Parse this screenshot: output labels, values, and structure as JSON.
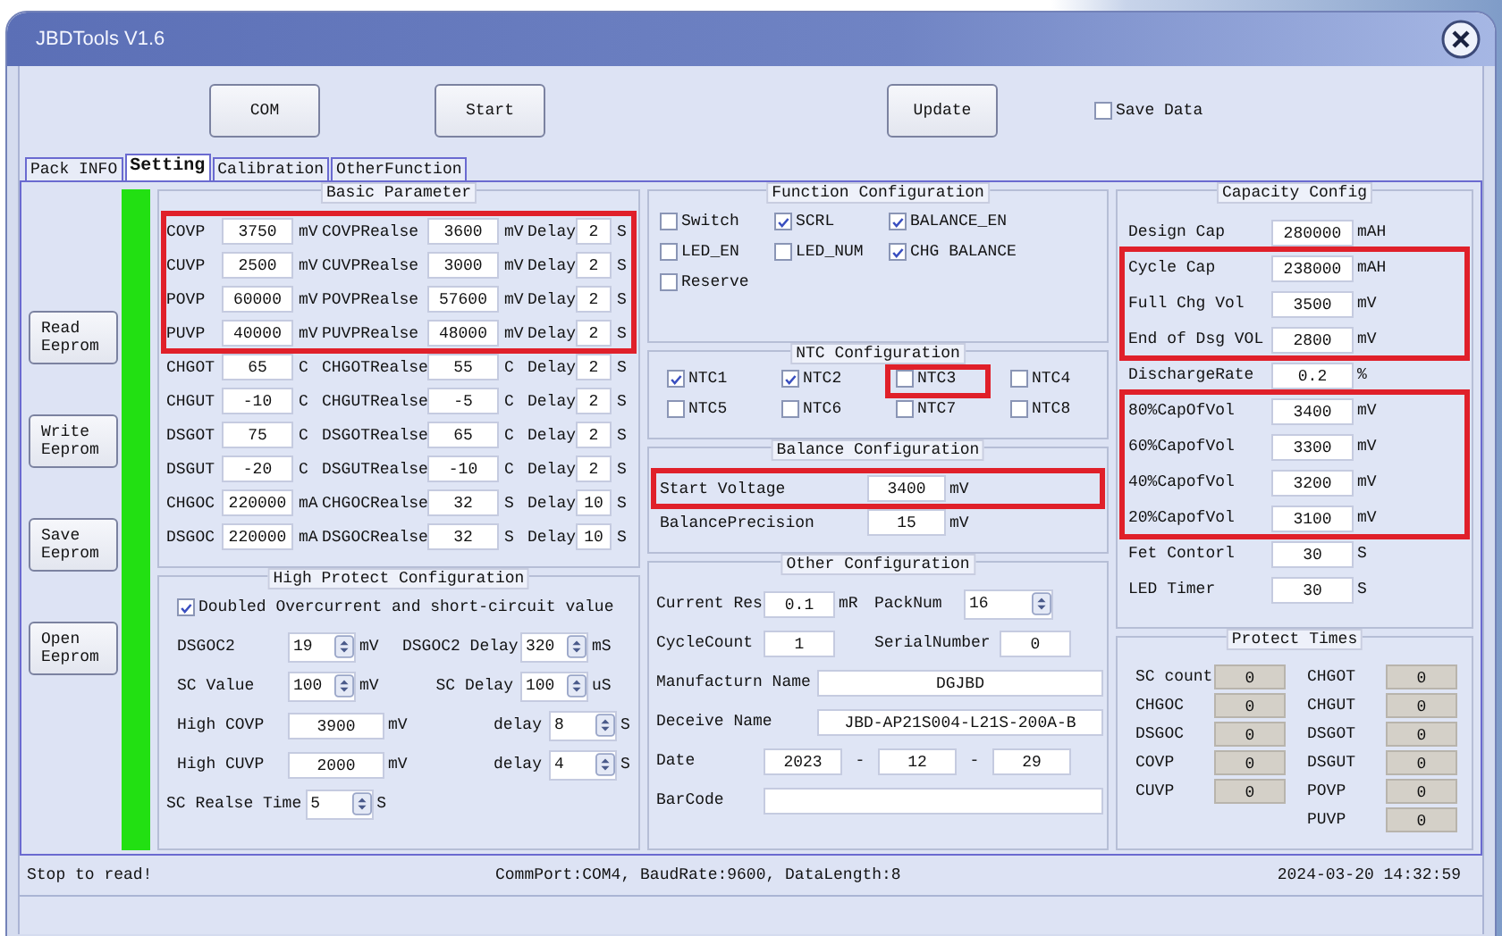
{
  "window": {
    "title": "JBDTools V1.6"
  },
  "toolbar": {
    "buttons": [
      "COM",
      "Start",
      "Update"
    ],
    "save_data": {
      "label": "Save Data",
      "checked": false
    }
  },
  "tabs": [
    {
      "label": "Pack INFO",
      "selected": false
    },
    {
      "label": "Setting",
      "selected": true
    },
    {
      "label": "Calibration",
      "selected": false
    },
    {
      "label": "OtherFunction",
      "selected": false
    }
  ],
  "side_buttons": [
    "Read Eeprom",
    "Write Eeprom",
    "Save Eeprom",
    "Open Eeprom"
  ],
  "basic_parameter": {
    "title": "Basic Parameter",
    "rows": [
      {
        "name": "COVP",
        "value": "3750",
        "unit": "mV",
        "release_name": "COVPRealse",
        "release_value": "3600",
        "release_unit": "mV",
        "delay_label": "Delay",
        "delay": "2",
        "delay_unit": "S",
        "highlighted": true
      },
      {
        "name": "CUVP",
        "value": "2500",
        "unit": "mV",
        "release_name": "CUVPRealse",
        "release_value": "3000",
        "release_unit": "mV",
        "delay_label": "Delay",
        "delay": "2",
        "delay_unit": "S",
        "highlighted": true
      },
      {
        "name": "POVP",
        "value": "60000",
        "unit": "mV",
        "release_name": "POVPRealse",
        "release_value": "57600",
        "release_unit": "mV",
        "delay_label": "Delay",
        "delay": "2",
        "delay_unit": "S",
        "highlighted": true
      },
      {
        "name": "PUVP",
        "value": "40000",
        "unit": "mV",
        "release_name": "PUVPRealse",
        "release_value": "48000",
        "release_unit": "mV",
        "delay_label": "Delay",
        "delay": "2",
        "delay_unit": "S",
        "highlighted": true
      },
      {
        "name": "CHGOT",
        "value": "65",
        "unit": "C",
        "release_name": "CHGOTRealse",
        "release_value": "55",
        "release_unit": "C",
        "delay_label": "Delay",
        "delay": "2",
        "delay_unit": "S",
        "highlighted": false
      },
      {
        "name": "CHGUT",
        "value": "-10",
        "unit": "C",
        "release_name": "CHGUTRealse",
        "release_value": "-5",
        "release_unit": "C",
        "delay_label": "Delay",
        "delay": "2",
        "delay_unit": "S",
        "highlighted": false
      },
      {
        "name": "DSGOT",
        "value": "75",
        "unit": "C",
        "release_name": "DSGOTRealse",
        "release_value": "65",
        "release_unit": "C",
        "delay_label": "Delay",
        "delay": "2",
        "delay_unit": "S",
        "highlighted": false
      },
      {
        "name": "DSGUT",
        "value": "-20",
        "unit": "C",
        "release_name": "DSGUTRealse",
        "release_value": "-10",
        "release_unit": "C",
        "delay_label": "Delay",
        "delay": "2",
        "delay_unit": "S",
        "highlighted": false
      },
      {
        "name": "CHGOC",
        "value": "220000",
        "unit": "mA",
        "release_name": "CHGOCRealse",
        "release_value": "32",
        "release_unit": "S",
        "delay_label": "Delay",
        "delay": "10",
        "delay_unit": "S",
        "highlighted": false
      },
      {
        "name": "DSGOC",
        "value": "220000",
        "unit": "mA",
        "release_name": "DSGOCRealse",
        "release_value": "32",
        "release_unit": "S",
        "delay_label": "Delay",
        "delay": "10",
        "delay_unit": "S",
        "highlighted": false
      }
    ]
  },
  "high_protect": {
    "title": "High Protect Configuration",
    "doubled": {
      "label": "Doubled Overcurrent and short-circuit value",
      "checked": true
    },
    "rows": [
      [
        {
          "kind": "spin",
          "label": "DSGOC2",
          "value": "19",
          "unit": "mV"
        },
        {
          "kind": "spin",
          "label": "DSGOC2 Delay",
          "value": "320",
          "unit": "mS"
        }
      ],
      [
        {
          "kind": "spin",
          "label": "SC Value",
          "value": "100",
          "unit": "mV"
        },
        {
          "kind": "spin",
          "label": "SC Delay",
          "value": "100",
          "unit": "uS"
        }
      ],
      [
        {
          "kind": "text",
          "label": "High COVP",
          "value": "3900",
          "unit": "mV"
        },
        {
          "kind": "spin",
          "label": "delay",
          "value": "8",
          "unit": "S"
        }
      ],
      [
        {
          "kind": "text",
          "label": "High CUVP",
          "value": "2000",
          "unit": "mV"
        },
        {
          "kind": "spin",
          "label": "delay",
          "value": "4",
          "unit": "S"
        }
      ],
      [
        {
          "kind": "spin",
          "label": "SC Realse Time",
          "value": "5",
          "unit": "S"
        }
      ]
    ]
  },
  "function_config": {
    "title": "Function Configuration",
    "options": [
      {
        "label": "Switch",
        "checked": false
      },
      {
        "label": "SCRL",
        "checked": true
      },
      {
        "label": "BALANCE_EN",
        "checked": true
      },
      {
        "label": "LED_EN",
        "checked": false
      },
      {
        "label": "LED_NUM",
        "checked": false
      },
      {
        "label": "CHG BALANCE",
        "checked": true
      },
      {
        "label": "Reserve",
        "checked": false
      }
    ]
  },
  "ntc_config": {
    "title": "NTC Configuration",
    "sensors": [
      {
        "label": "NTC1",
        "checked": true,
        "highlighted": false
      },
      {
        "label": "NTC2",
        "checked": true,
        "highlighted": false
      },
      {
        "label": "NTC3",
        "checked": false,
        "highlighted": true
      },
      {
        "label": "NTC4",
        "checked": false,
        "highlighted": false
      },
      {
        "label": "NTC5",
        "checked": false,
        "highlighted": false
      },
      {
        "label": "NTC6",
        "checked": false,
        "highlighted": false
      },
      {
        "label": "NTC7",
        "checked": false,
        "highlighted": false
      },
      {
        "label": "NTC8",
        "checked": false,
        "highlighted": false
      }
    ]
  },
  "balance_config": {
    "title": "Balance Configuration",
    "fields": [
      {
        "label": "Start Voltage",
        "value": "3400",
        "unit": "mV",
        "highlighted": true
      },
      {
        "label": "BalancePrecision",
        "value": "15",
        "unit": "mV",
        "highlighted": false
      }
    ]
  },
  "other_config": {
    "title": "Other Configuration",
    "rows": [
      [
        {
          "kind": "text",
          "label": "Current Res",
          "value": "0.1",
          "unit": "mR"
        },
        {
          "kind": "spin",
          "label": "PackNum",
          "value": "16"
        }
      ],
      [
        {
          "kind": "text",
          "label": "CycleCount",
          "value": "1"
        },
        {
          "kind": "text",
          "label": "SerialNumber",
          "value": "0"
        }
      ],
      [
        {
          "kind": "wide",
          "label": "Manufacturn Name",
          "value": "DGJBD"
        }
      ],
      [
        {
          "kind": "wide",
          "label": "Deceive Name",
          "value": "JBD-AP21S004-L21S-200A-B"
        }
      ],
      [
        {
          "kind": "date",
          "label": "Date",
          "parts": [
            "2023",
            "12",
            "29"
          ],
          "separators": [
            "-",
            "-"
          ]
        }
      ],
      [
        {
          "kind": "wide",
          "label": "BarCode"
        }
      ]
    ]
  },
  "capacity_config": {
    "title": "Capacity Config",
    "fields": [
      {
        "label": "Design Cap",
        "value": "280000",
        "unit": "mAH",
        "highlighted": false
      },
      {
        "label": "Cycle Cap",
        "value": "238000",
        "unit": "mAH",
        "highlighted": true
      },
      {
        "label": "Full Chg Vol",
        "value": "3500",
        "unit": "mV",
        "highlighted": true
      },
      {
        "label": "End of Dsg VOL",
        "value": "2800",
        "unit": "mV",
        "highlighted": true
      },
      {
        "label": "DischargeRate",
        "value": "0.2",
        "unit": "%",
        "highlighted": false
      },
      {
        "label": "80%CapOfVol",
        "value": "3400",
        "unit": "mV",
        "highlighted": true
      },
      {
        "label": "60%CapofVol",
        "value": "3300",
        "unit": "mV",
        "highlighted": true
      },
      {
        "label": "40%CapofVol",
        "value": "3200",
        "unit": "mV",
        "highlighted": true
      },
      {
        "label": "20%CapofVol",
        "value": "3100",
        "unit": "mV",
        "highlighted": true
      },
      {
        "label": "Fet Contorl",
        "value": "30",
        "unit": "S",
        "highlighted": false
      },
      {
        "label": "LED Timer",
        "value": "30",
        "unit": "S",
        "highlighted": false
      }
    ]
  },
  "protect_times": {
    "title": "Protect Times",
    "left": [
      {
        "label": "SC count",
        "value": "0"
      },
      {
        "label": "CHGOC",
        "value": "0"
      },
      {
        "label": "DSGOC",
        "value": "0"
      },
      {
        "label": "COVP",
        "value": "0"
      },
      {
        "label": "CUVP",
        "value": "0"
      }
    ],
    "right": [
      {
        "label": "CHGOT",
        "value": "0"
      },
      {
        "label": "CHGUT",
        "value": "0"
      },
      {
        "label": "DSGOT",
        "value": "0"
      },
      {
        "label": "DSGUT",
        "value": "0"
      },
      {
        "label": "POVP",
        "value": "0"
      },
      {
        "label": "PUVP",
        "value": "0"
      }
    ]
  },
  "status_bar": {
    "message": "Stop to read!",
    "connection": "CommPort:COM4, BaudRate:9600, DataLength:8",
    "datetime": "2024-03-20 14:32:59"
  }
}
